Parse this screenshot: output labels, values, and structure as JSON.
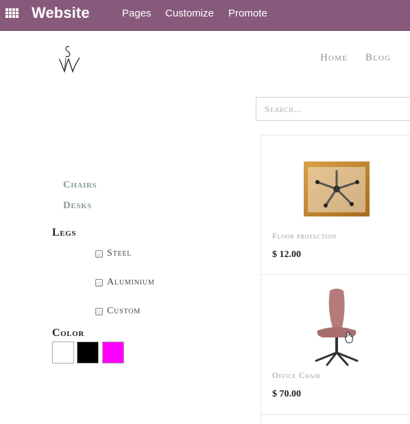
{
  "topbar": {
    "brand": "Website",
    "menu": [
      "Pages",
      "Customize",
      "Promote"
    ],
    "bg_color": "#875a7b"
  },
  "header": {
    "logo_icon": "sw-monogram-logo",
    "nav": [
      "Home",
      "Blog"
    ]
  },
  "search": {
    "placeholder": "Search..."
  },
  "sidebar": {
    "categories": [
      "Chairs",
      "Desks"
    ],
    "attributes": [
      {
        "title": "Legs",
        "options": [
          "Steel",
          "Aluminium",
          "Custom"
        ]
      },
      {
        "title": "Color",
        "swatches": [
          "#ffffff",
          "#000000",
          "#ff00ff"
        ]
      }
    ]
  },
  "products": [
    {
      "name": "Floor protection",
      "price": "$ 12.00",
      "image_icon": "floor-mat-photo"
    },
    {
      "name": "Office Chair",
      "price": "$ 70.00",
      "image_icon": "office-chair-photo"
    }
  ]
}
